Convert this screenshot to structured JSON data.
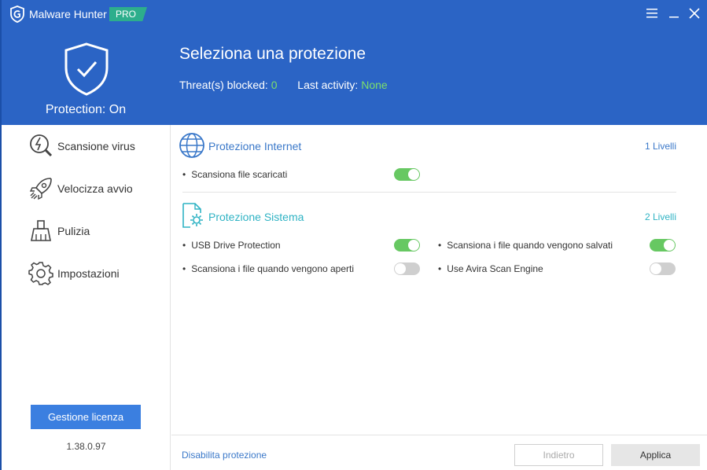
{
  "app": {
    "title": "Malware Hunter",
    "badge": "PRO",
    "colors": {
      "header": "#2b64c5",
      "accent_green": "#7ddf6b",
      "toggle_on": "#67c862",
      "button_blue": "#3b7fe0"
    }
  },
  "header": {
    "protection_status": "Protection: On",
    "page_title": "Seleziona una protezione",
    "threats_label": "Threat(s) blocked:",
    "threats_value": "0",
    "activity_label": "Last activity:",
    "activity_value": "None"
  },
  "window_controls": {
    "menu_icon": "hamburger-icon",
    "minimize_icon": "minimize-icon",
    "close_icon": "close-icon"
  },
  "sidebar": {
    "items": [
      {
        "label": "Scansione virus",
        "icon": "scan-search-icon"
      },
      {
        "label": "Velocizza avvio",
        "icon": "rocket-icon"
      },
      {
        "label": "Pulizia",
        "icon": "broom-icon"
      },
      {
        "label": "Impostazioni",
        "icon": "gear-icon"
      }
    ],
    "license_button": "Gestione licenza",
    "version": "1.38.0.97"
  },
  "sections": {
    "internet": {
      "title": "Protezione Internet",
      "level": "1 Livelli",
      "color": "#3a78c9",
      "icon": "globe-icon",
      "options": [
        {
          "label": "Scansiona file scaricati",
          "enabled": true
        }
      ]
    },
    "system": {
      "title": "Protezione Sistema",
      "level": "2 Livelli",
      "color": "#2fb3c4",
      "icon": "file-gear-icon",
      "options": [
        {
          "label": "USB Drive Protection",
          "enabled": true
        },
        {
          "label": "Scansiona i file quando vengono salvati",
          "enabled": true
        },
        {
          "label": "Scansiona i file quando vengono aperti",
          "enabled": false
        },
        {
          "label": "Use Avira Scan Engine",
          "enabled": false
        }
      ]
    }
  },
  "footer": {
    "disable_link": "Disabilita protezione",
    "back_button": "Indietro",
    "apply_button": "Applica"
  }
}
